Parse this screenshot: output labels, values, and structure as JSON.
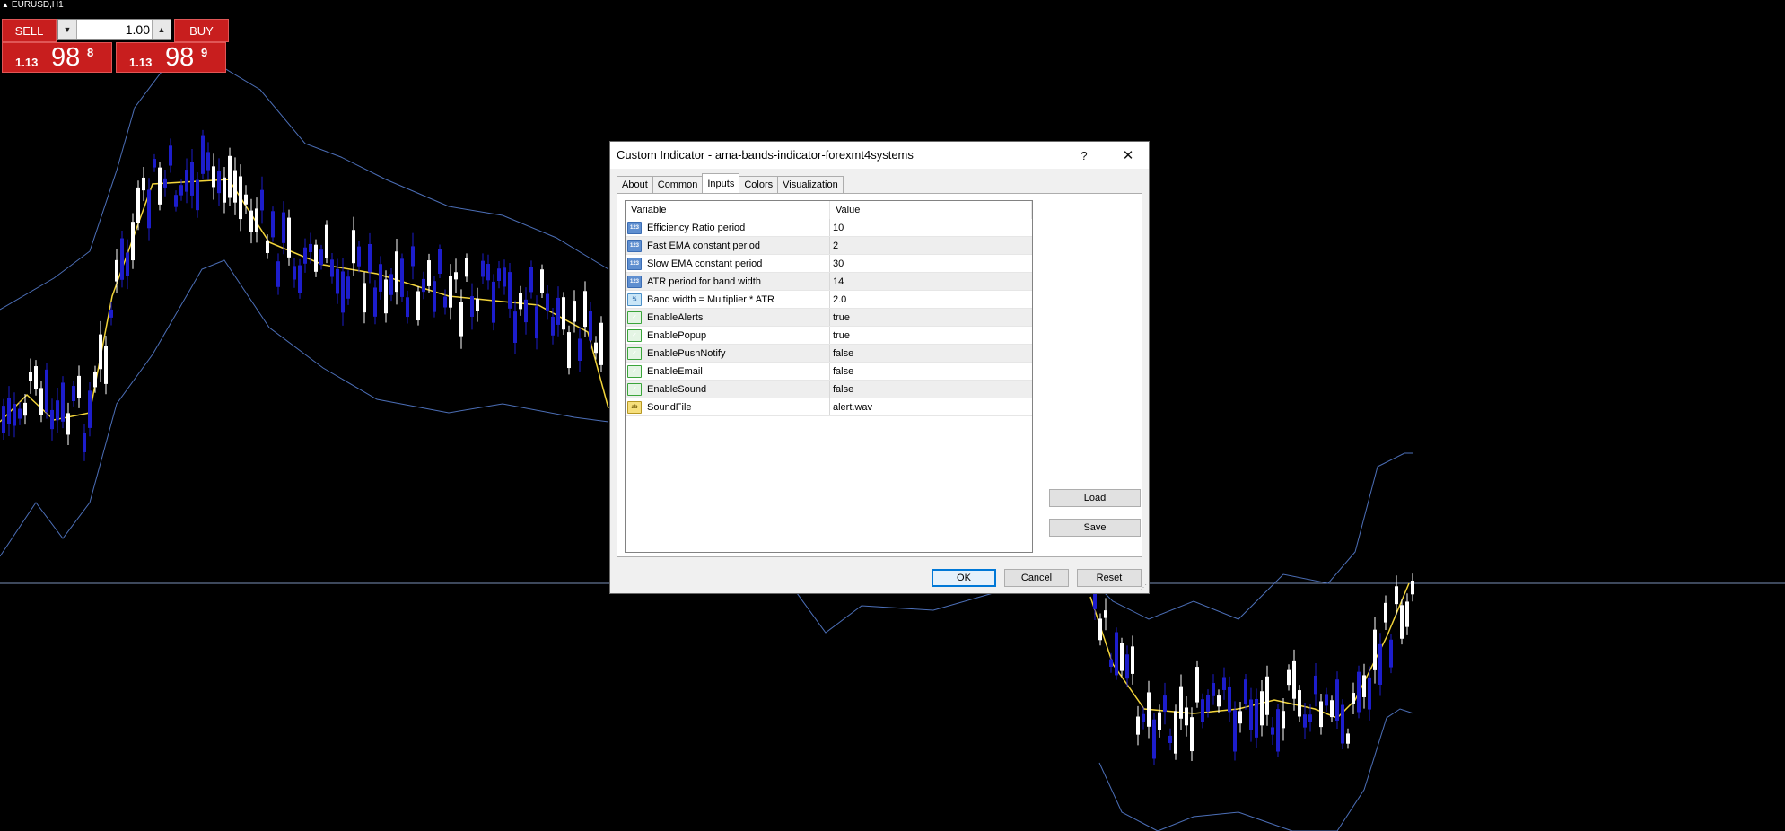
{
  "chart": {
    "symbol": "EURUSD,H1",
    "colors": {
      "background": "#000000",
      "bull_candle": "#ffffff",
      "bear_candle": "#1d1dcc",
      "ama_line": "#f2d43a",
      "bands": "#4c6fb8",
      "price_line": "#7a8fb8"
    }
  },
  "trade_panel": {
    "sell_label": "SELL",
    "buy_label": "BUY",
    "lot_value": "1.00",
    "down_icon": "arrow-down-icon",
    "up_icon": "arrow-up-icon",
    "sell_quote": {
      "big": "1.13",
      "main": "98",
      "sup": "8"
    },
    "buy_quote": {
      "big": "1.13",
      "main": "98",
      "sup": "9"
    },
    "button_color": "#c81e1e"
  },
  "dialog": {
    "title": "Custom Indicator - ama-bands-indicator-forexmt4systems",
    "help_label": "?",
    "close_label": "✕",
    "tabs": [
      "About",
      "Common",
      "Inputs",
      "Colors",
      "Visualization"
    ],
    "active_tab": "Inputs",
    "grid": {
      "headers": {
        "variable": "Variable",
        "value": "Value"
      },
      "rows": [
        {
          "type": "int",
          "icon": "integer-type-icon",
          "variable": "Efficiency Ratio period",
          "value": "10"
        },
        {
          "type": "int",
          "icon": "integer-type-icon",
          "variable": "Fast EMA constant period",
          "value": "2"
        },
        {
          "type": "int",
          "icon": "integer-type-icon",
          "variable": "Slow EMA constant period",
          "value": "30"
        },
        {
          "type": "int",
          "icon": "integer-type-icon",
          "variable": "ATR period for band width",
          "value": "14"
        },
        {
          "type": "dbl",
          "icon": "double-type-icon",
          "variable": "Band width = Multiplier * ATR",
          "value": "2.0"
        },
        {
          "type": "bool",
          "icon": "boolean-type-icon",
          "variable": "EnableAlerts",
          "value": "true"
        },
        {
          "type": "bool",
          "icon": "boolean-type-icon",
          "variable": "EnablePopup",
          "value": "true"
        },
        {
          "type": "bool",
          "icon": "boolean-type-icon",
          "variable": "EnablePushNotify",
          "value": "false"
        },
        {
          "type": "bool",
          "icon": "boolean-type-icon",
          "variable": "EnableEmail",
          "value": "false"
        },
        {
          "type": "bool",
          "icon": "boolean-type-icon",
          "variable": "EnableSound",
          "value": "false"
        },
        {
          "type": "str",
          "icon": "string-type-icon",
          "variable": "SoundFile",
          "value": "alert.wav"
        }
      ]
    },
    "buttons": {
      "load": "Load",
      "save": "Save",
      "ok": "OK",
      "cancel": "Cancel",
      "reset": "Reset"
    }
  }
}
